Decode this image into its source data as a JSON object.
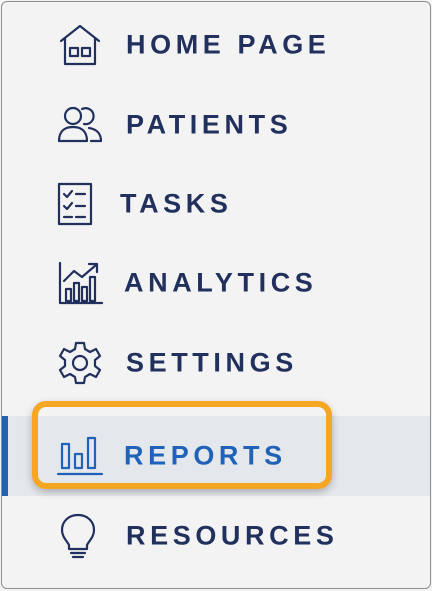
{
  "nav": {
    "items": [
      {
        "id": "home",
        "label": "HOME PAGE",
        "icon": "house-icon"
      },
      {
        "id": "patients",
        "label": "PATIENTS",
        "icon": "users-icon"
      },
      {
        "id": "tasks",
        "label": "TASKS",
        "icon": "checklist-icon"
      },
      {
        "id": "analytics",
        "label": "ANALYTICS",
        "icon": "trend-chart-icon"
      },
      {
        "id": "settings",
        "label": "SETTINGS",
        "icon": "gear-icon"
      },
      {
        "id": "reports",
        "label": "REPORTS",
        "icon": "bar-chart-icon",
        "active": true
      },
      {
        "id": "resources",
        "label": "RESOURCES",
        "icon": "lightbulb-icon"
      }
    ],
    "active_item": "REPORTS"
  },
  "colors": {
    "text": "#21305d",
    "active_text": "#1f62b8",
    "active_bar": "#1f62b8",
    "highlight_border": "#f5a623",
    "background": "#f3f3f3",
    "active_background": "#e4e7eb"
  }
}
